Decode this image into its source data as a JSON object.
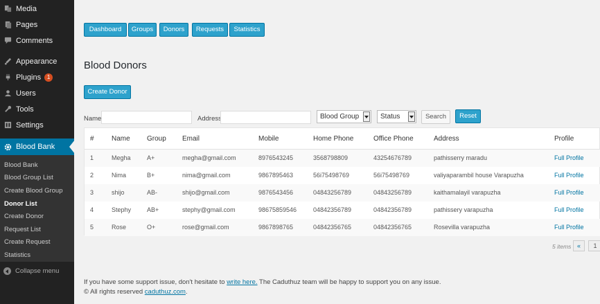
{
  "sidebar": {
    "menu": [
      {
        "label": "Media",
        "icon": "media-icon"
      },
      {
        "label": "Pages",
        "icon": "pages-icon"
      },
      {
        "label": "Comments",
        "icon": "comments-icon"
      },
      {
        "label": "Appearance",
        "icon": "appearance-icon"
      },
      {
        "label": "Plugins",
        "icon": "plugins-icon",
        "badge": "1"
      },
      {
        "label": "Users",
        "icon": "users-icon"
      },
      {
        "label": "Tools",
        "icon": "tools-icon"
      },
      {
        "label": "Settings",
        "icon": "settings-icon"
      },
      {
        "label": "Blood Bank",
        "icon": "gear-icon"
      }
    ],
    "submenu": [
      "Blood Bank",
      "Blood Group List",
      "Create Blood Group",
      "Donor List",
      "Create Donor",
      "Request List",
      "Create Request",
      "Statistics"
    ],
    "current_submenu": "Donor List",
    "collapse_label": "Collapse menu"
  },
  "nav_tabs": [
    "Dashboard",
    "Groups",
    "Donors",
    "Requests",
    "Statistics"
  ],
  "page_title": "Blood Donors",
  "create_button": "Create Donor",
  "filters": {
    "name_label": "Name",
    "name_value": "",
    "address_label": "Address",
    "address_value": "",
    "group_select": "Blood Group",
    "status_select": "Status",
    "search_button": "Search",
    "reset_button": "Reset"
  },
  "table": {
    "columns": [
      "#",
      "Name",
      "Group",
      "Email",
      "Mobile",
      "Home Phone",
      "Office Phone",
      "Address",
      "Profile"
    ],
    "rows": [
      [
        "1",
        "Megha",
        "A+",
        "megha@gmail.com",
        "8976543245",
        "3568798809",
        "43254676789",
        "pathisserry maradu",
        "Full Profile"
      ],
      [
        "2",
        "Nima",
        "B+",
        "nima@gmail.com",
        "9867895463",
        "56i75498769",
        "56i75498769",
        "valiyaparambil house Varapuzha",
        "Full Profile"
      ],
      [
        "3",
        "shijo",
        "AB-",
        "shijo@gmail.com",
        "9876543456",
        "04843256789",
        "04843256789",
        "kaithamalayil varapuzha",
        "Full Profile"
      ],
      [
        "4",
        "Stephy",
        "AB+",
        "stephy@gmail.com",
        "98675859546",
        "04842356789",
        "04842356789",
        "pathissery varapuzha",
        "Full Profile"
      ],
      [
        "5",
        "Rose",
        "O+",
        "rose@gmail.com",
        "9867898765",
        "04842356765",
        "04842356765",
        "Rosevilla varapuzha",
        "Full Profile"
      ]
    ]
  },
  "pagination": {
    "count_text": "5 items",
    "first": "«",
    "page": "1"
  },
  "footer": {
    "support_pre": "If you have some support issue, don't hesitate to ",
    "support_link": "write here.",
    "support_post": " The Caduthuz team will be happy to support you on any issue.",
    "copyright_pre": "© All rights reserved ",
    "copyright_link": "caduthuz.com",
    "copyright_post": "."
  },
  "colors": {
    "accent": "#2ea2cc",
    "sidebar_bg": "#222222",
    "active_menu": "#0074a2",
    "link": "#0074a2"
  }
}
